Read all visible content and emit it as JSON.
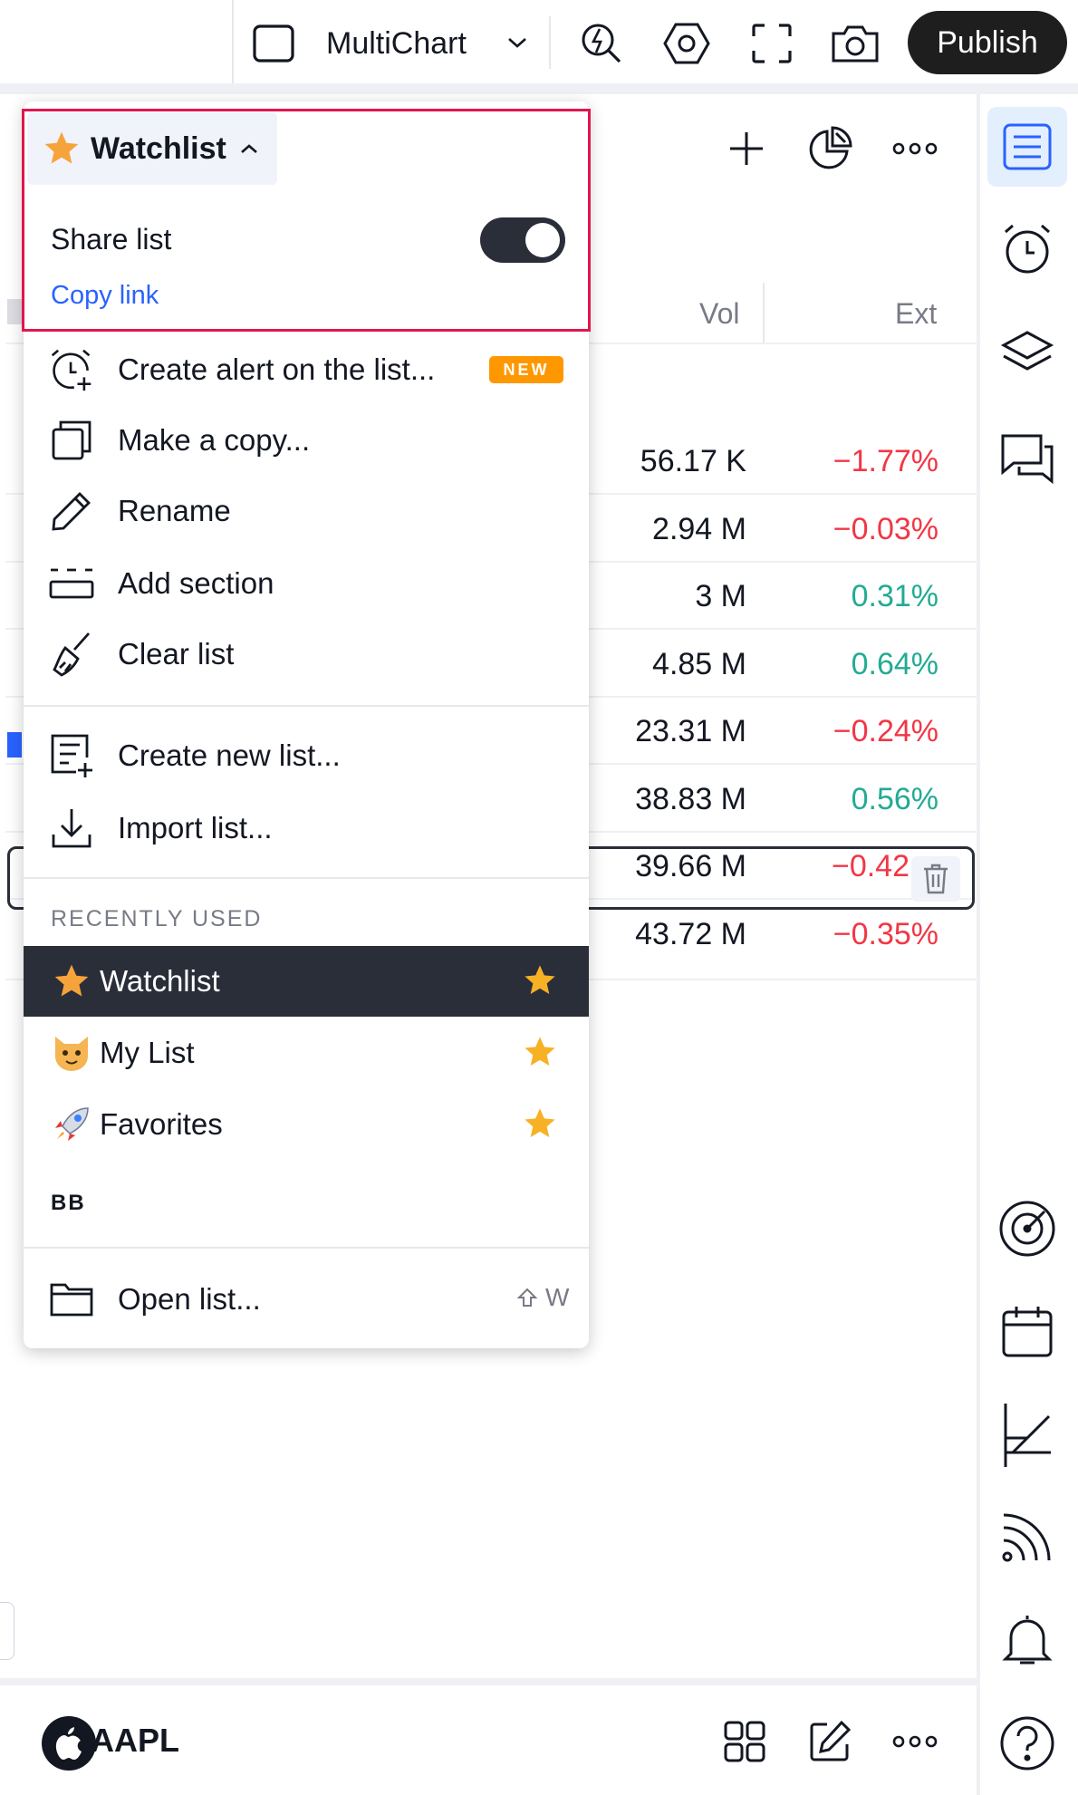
{
  "topbar": {
    "layout_label": "MultiChart",
    "publish_label": "Publish"
  },
  "watchlist": {
    "columns": {
      "vol": "Vol",
      "ext": "Ext"
    },
    "rows": [
      {
        "vol": "56.17 K",
        "chg": "−1.77%",
        "dir": "neg"
      },
      {
        "vol": "2.94 M",
        "chg": "−0.03%",
        "dir": "neg"
      },
      {
        "vol": "3 M",
        "chg": "0.31%",
        "dir": "pos"
      },
      {
        "vol": "4.85 M",
        "chg": "0.64%",
        "dir": "pos"
      },
      {
        "vol": "23.31 M",
        "chg": "−0.24%",
        "dir": "neg"
      },
      {
        "vol": "38.83 M",
        "chg": "0.56%",
        "dir": "pos"
      },
      {
        "vol": "39.66 M",
        "chg": "−0.42",
        "dir": "neg"
      },
      {
        "vol": "43.72 M",
        "chg": "−0.35%",
        "dir": "neg"
      }
    ]
  },
  "menu": {
    "title": "Watchlist",
    "share_label": "Share list",
    "share_enabled": true,
    "copy_link": "Copy link",
    "items": {
      "create_alert": "Create alert on the list...",
      "new_badge": "NEW",
      "make_copy": "Make a copy...",
      "rename": "Rename",
      "add_section": "Add section",
      "clear_list": "Clear list",
      "create_new": "Create new list...",
      "import": "Import list...",
      "open": "Open list...",
      "open_shortcut_key": "W"
    },
    "recent_title": "RECENTLY USED",
    "recent": [
      {
        "label": "Watchlist",
        "emoji": "star",
        "active": true,
        "favorite": true
      },
      {
        "label": "My List",
        "emoji": "cat",
        "active": false,
        "favorite": true
      },
      {
        "label": "Favorites",
        "emoji": "rocket",
        "active": false,
        "favorite": true
      }
    ],
    "bb_label": "BB"
  },
  "bottom": {
    "symbol": "AAPL"
  },
  "colors": {
    "accent": "#2962ff",
    "positive": "#22ab94",
    "negative": "#f23645",
    "badge": "#ff9800",
    "star": "#f7b125",
    "highlight": "#e0164f"
  }
}
